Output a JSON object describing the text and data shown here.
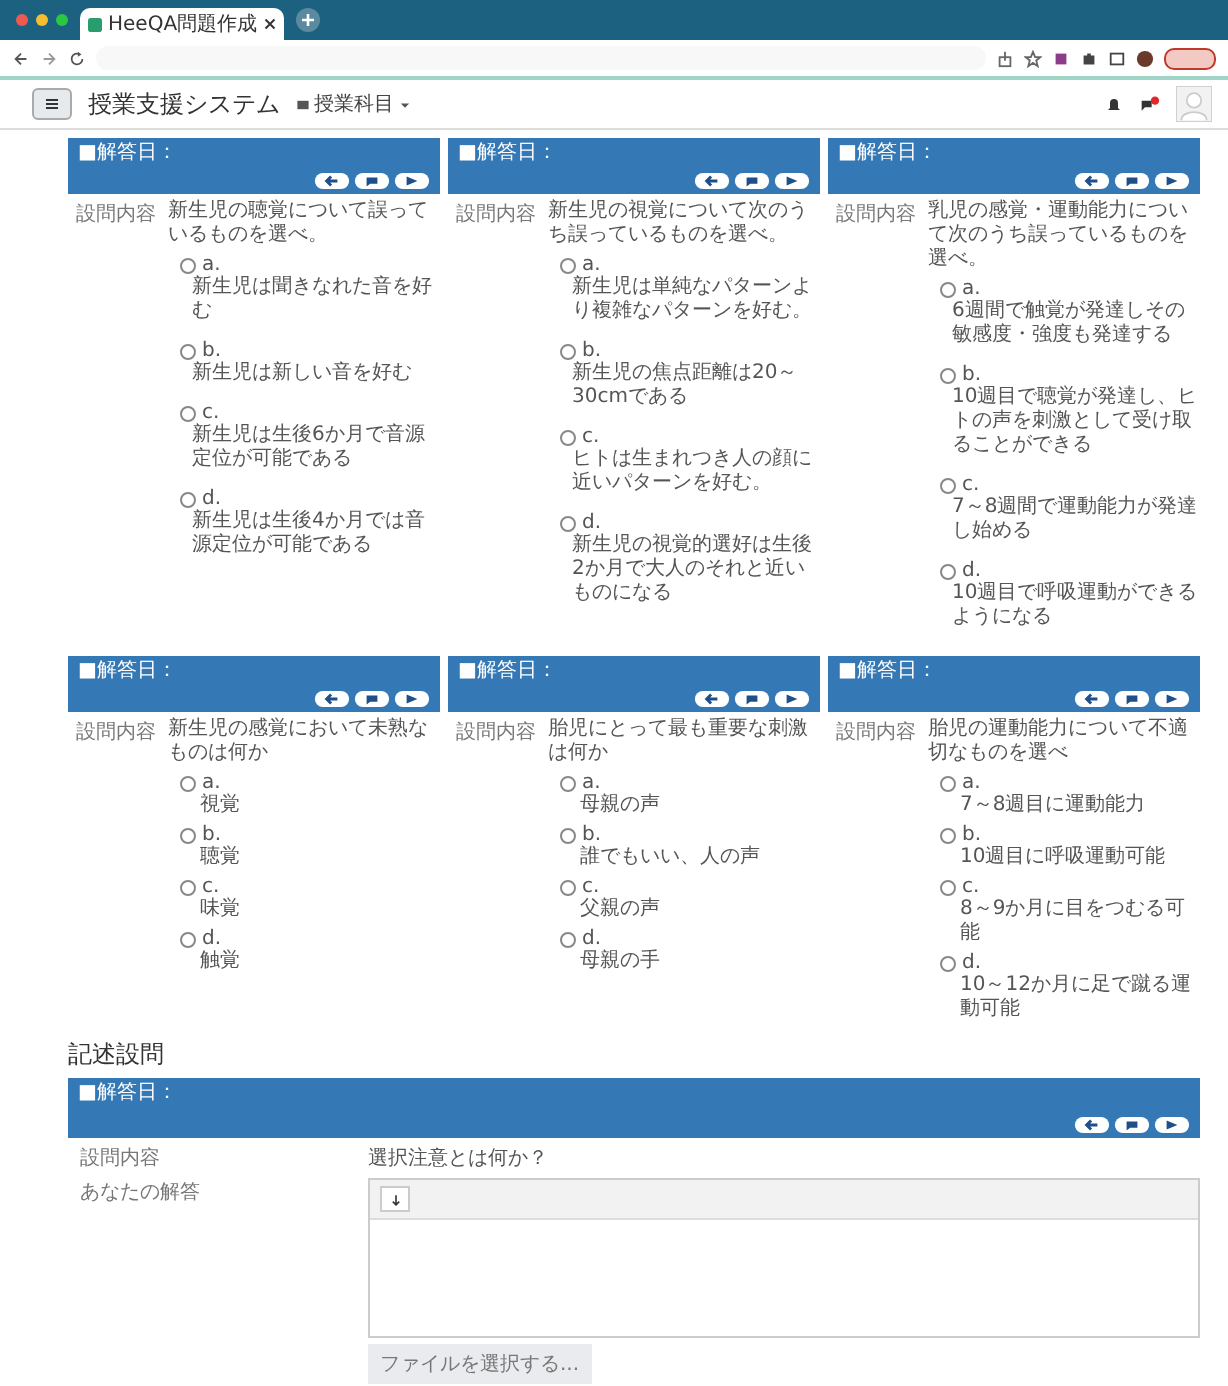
{
  "browser": {
    "tab_title": "HeeQA問題作成"
  },
  "app": {
    "title": "授業支援システム",
    "course_menu": "授業科目"
  },
  "choice_questions": [
    {
      "header": "■解答日：",
      "label": "設問内容",
      "question": "新生児の聴覚について誤っているものを選べ。",
      "options": [
        {
          "letter": "a.",
          "text": "新生児は聞きなれた音を好む",
          "selected": false
        },
        {
          "letter": "b.",
          "text": "新生児は新しい音を好む",
          "selected": false
        },
        {
          "letter": "c.",
          "text": "新生児は生後6か月で音源定位が可能である",
          "selected": false
        },
        {
          "letter": "d.",
          "text": "新生児は生後4か月では音源定位が可能である",
          "selected": false
        }
      ]
    },
    {
      "header": "■解答日：",
      "label": "設問内容",
      "question": "新生児の視覚について次のうち誤っているものを選べ。",
      "options": [
        {
          "letter": "a.",
          "text": "新生児は単純なパターンより複雑なパターンを好む。",
          "selected": false
        },
        {
          "letter": "b.",
          "text": "新生児の焦点距離は20～30cmである",
          "selected": false
        },
        {
          "letter": "c.",
          "text": "ヒトは生まれつき人の顔に近いパターンを好む。",
          "selected": false
        },
        {
          "letter": "d.",
          "text": "新生児の視覚的選好は生後2か月で大人のそれと近いものになる",
          "selected": false
        }
      ]
    },
    {
      "header": "■解答日：",
      "label": "設問内容",
      "question": "乳児の感覚・運動能力について次のうち誤っているものを選べ。",
      "options": [
        {
          "letter": "a.",
          "text": "6週間で触覚が発達しその敏感度・強度も発達する",
          "selected": false
        },
        {
          "letter": "b.",
          "text": "10週目で聴覚が発達し、ヒトの声を刺激として受け取ることができる",
          "selected": false
        },
        {
          "letter": "c.",
          "text": "7～8週間で運動能力が発達し始める",
          "selected": false
        },
        {
          "letter": "d.",
          "text": "10週目で呼吸運動ができるようになる",
          "selected": false
        }
      ]
    },
    {
      "header": "■解答日：",
      "label": "設問内容",
      "question": "新生児の感覚において未熟なものは何か",
      "options": [
        {
          "letter": "a.",
          "text": "視覚",
          "selected": false
        },
        {
          "letter": "b.",
          "text": "聴覚",
          "selected": false
        },
        {
          "letter": "c.",
          "text": "味覚",
          "selected": false
        },
        {
          "letter": "d.",
          "text": "触覚",
          "selected": false
        }
      ]
    },
    {
      "header": "■解答日：",
      "label": "設問内容",
      "question": "胎児にとって最も重要な刺激は何か",
      "options": [
        {
          "letter": "a.",
          "text": "母親の声",
          "selected": false
        },
        {
          "letter": "b.",
          "text": "誰でもいい、人の声",
          "selected": false
        },
        {
          "letter": "c.",
          "text": "父親の声",
          "selected": false
        },
        {
          "letter": "d.",
          "text": "母親の手",
          "selected": false
        }
      ]
    },
    {
      "header": "■解答日：",
      "label": "設問内容",
      "question": "胎児の運動能力について不適切なものを選べ",
      "options": [
        {
          "letter": "a.",
          "text": "7～8週目に運動能力",
          "selected": false
        },
        {
          "letter": "b.",
          "text": "10週目に呼吸運動可能",
          "selected": false
        },
        {
          "letter": "c.",
          "text": "8～9か月に目をつむる可能",
          "selected": false
        },
        {
          "letter": "d.",
          "text": "10～12か月に足で蹴る運動可能",
          "selected": false
        }
      ]
    }
  ],
  "written_section": {
    "heading": "記述設問",
    "header": "■解答日：",
    "question_label": "設問内容",
    "question": "選択注意とは何か？",
    "answer_label": "あなたの解答",
    "file_button": "ファイルを選択する..."
  }
}
